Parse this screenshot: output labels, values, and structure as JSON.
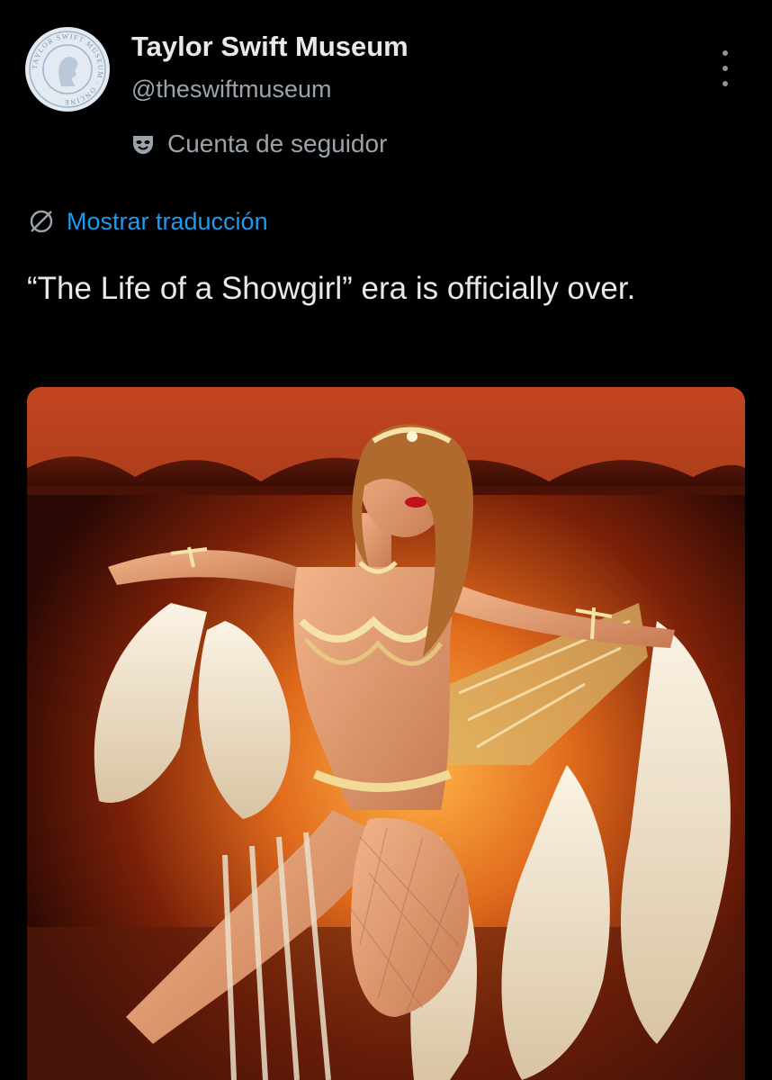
{
  "account": {
    "name": "Taylor Swift Museum",
    "handle": "@theswiftmuseum",
    "parody_label": "Cuenta de seguidor",
    "avatar_text": "TAYLOR SWIFT MUSEUM · ONLINE"
  },
  "icons": {
    "parody": "mask-icon",
    "translate": "globe-icon",
    "more": "more-options-icon"
  },
  "translate": {
    "label": "Mostrar traducción"
  },
  "tweet": {
    "text": "“The Life of a Showgirl” era is officially over."
  },
  "media": {
    "type": "photo"
  },
  "colors": {
    "background": "#000000",
    "primary_text": "#e7e9ea",
    "secondary_text": "#9ba3ab",
    "link": "#1d9bf0"
  }
}
